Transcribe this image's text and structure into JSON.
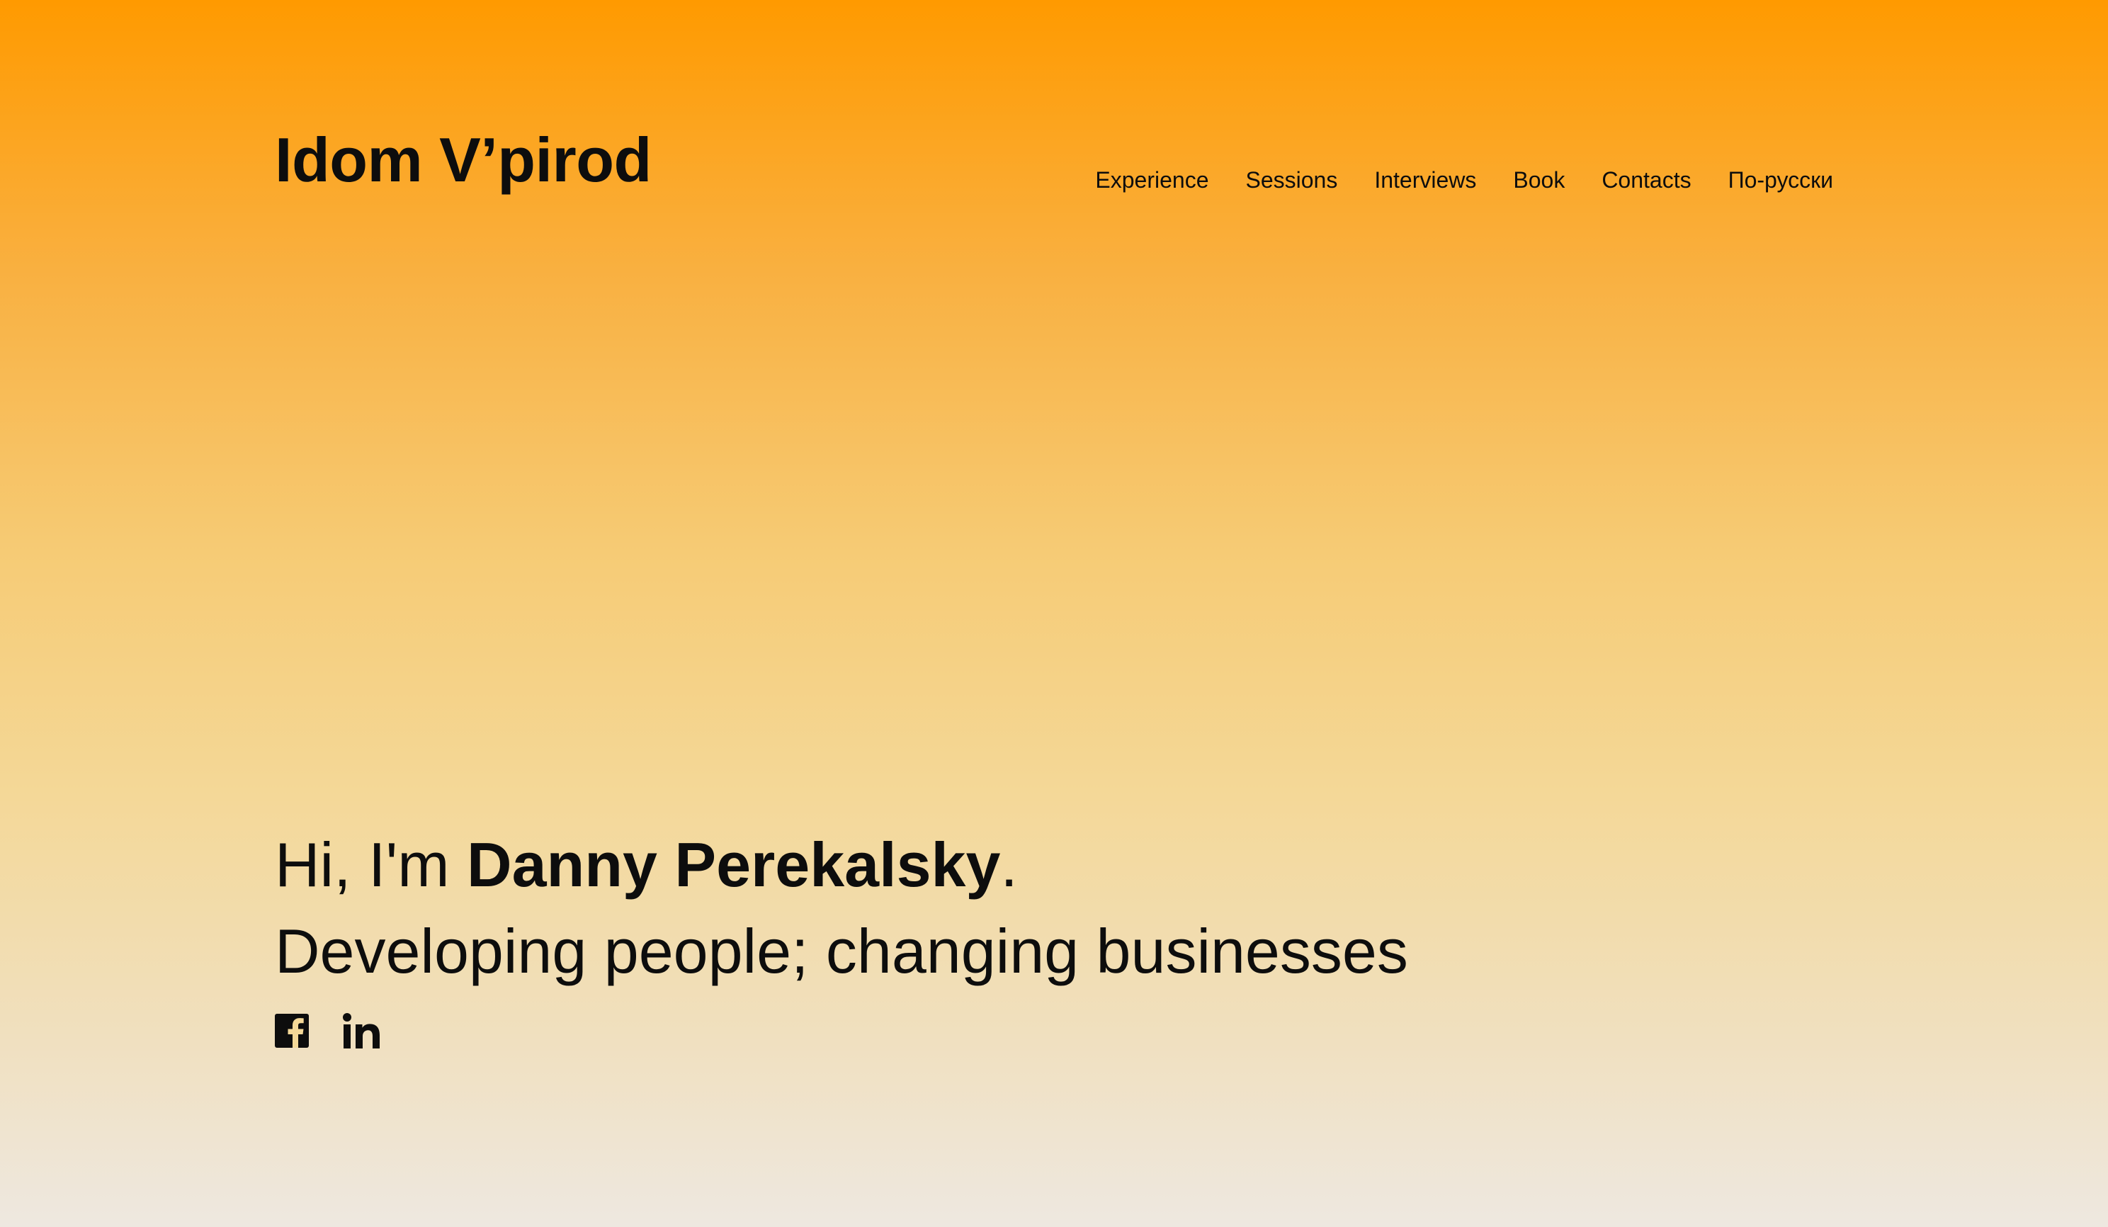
{
  "header": {
    "logo": "Idom V’pirod",
    "nav": [
      {
        "label": "Experience"
      },
      {
        "label": "Sessions"
      },
      {
        "label": "Interviews"
      },
      {
        "label": "Book"
      },
      {
        "label": "Contacts"
      },
      {
        "label": "По-русски"
      }
    ]
  },
  "hero": {
    "greeting": "Hi, I'm ",
    "name": "Danny Perekalsky",
    "period": ".",
    "tagline": "Developing people; changing businesses"
  },
  "socials": [
    {
      "icon": "facebook-icon"
    },
    {
      "icon": "linkedin-icon"
    }
  ],
  "colors": {
    "gradient_top": "#ff9a00",
    "gradient_bottom": "#eee8e0",
    "text": "#0d0d0d"
  }
}
